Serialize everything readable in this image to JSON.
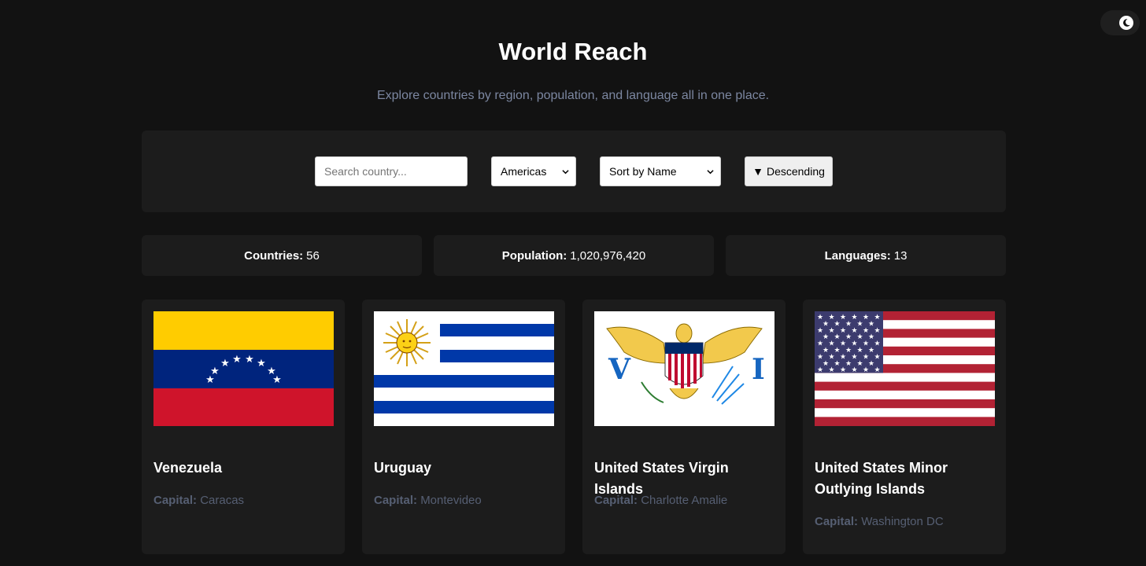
{
  "header": {
    "title": "World Reach",
    "subtitle": "Explore countries by region, population, and language all in one place."
  },
  "theme_toggle": {
    "icon": "moon-icon"
  },
  "controls": {
    "search_placeholder": "Search country...",
    "search_value": "",
    "region_selected": "Americas",
    "sort_selected": "Sort by Name",
    "order_arrow": "▼",
    "order_label": "Descending"
  },
  "stats": [
    {
      "label": "Countries:",
      "value": "56"
    },
    {
      "label": "Population:",
      "value": "1,020,976,420"
    },
    {
      "label": "Languages:",
      "value": "13"
    }
  ],
  "countries": [
    {
      "name": "Venezuela",
      "capital_label": "Capital:",
      "capital": "Caracas",
      "flag": "venezuela-flag"
    },
    {
      "name": "Uruguay",
      "capital_label": "Capital:",
      "capital": "Montevideo",
      "flag": "uruguay-flag"
    },
    {
      "name": "United States Virgin Islands",
      "capital_label": "Capital:",
      "capital": "Charlotte Amalie",
      "flag": "us-virgin-islands-flag"
    },
    {
      "name": "United States Minor Outlying Islands",
      "capital_label": "Capital:",
      "capital": "Washington DC",
      "flag": "united-states-flag"
    }
  ]
}
